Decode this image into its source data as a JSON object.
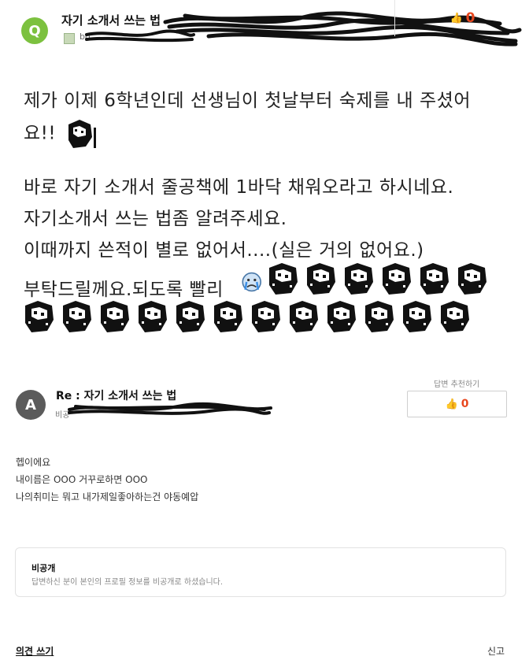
{
  "question": {
    "badge": "Q",
    "title": "자기 소개서 쓰는 법",
    "user": "bo",
    "like_count": "0",
    "body_lines": {
      "l1": "제가 이제 6학년인데 선생님이 첫날부터 숙제를 내 주셨어",
      "l2": "요!!",
      "l3": "바로 자기 소개서 줄공책에 1바닥 채워오라고 하시네요.",
      "l4": "자기소개서 쓰는 법좀 알려주세요.",
      "l5": "이때까지 쓴적이 별로 없어서....(실은 거의 없어요.)",
      "l6": "부탁드릴께요.되도록 빨리"
    }
  },
  "answer": {
    "badge": "A",
    "title": "Re : 자기 소개서 쓰는 법",
    "user": "비공",
    "recommend_label": "답변 추천하기",
    "recommend_count": "0",
    "body_lines": {
      "l1": "헵이에요",
      "l2": "내이름은 OOO 거꾸로하면 OOO",
      "l3": "나의취미는 뭐고 내가제일좋아하는건 야동예압"
    },
    "private": {
      "title": "비공개",
      "desc": "답변하신 분이 본인의 프로필 정보를 비공개로 하셨습니다."
    }
  },
  "footer": {
    "opinion": "의견 쓰기",
    "report": "신고"
  },
  "colors": {
    "q_badge": "#7cc13f",
    "a_badge": "#5b5b5b",
    "like": "#e8471e"
  },
  "icons": [
    "thumbs-up-icon",
    "user-profile-icon",
    "crying-emoticon",
    "pixel-face-emoticon"
  ]
}
